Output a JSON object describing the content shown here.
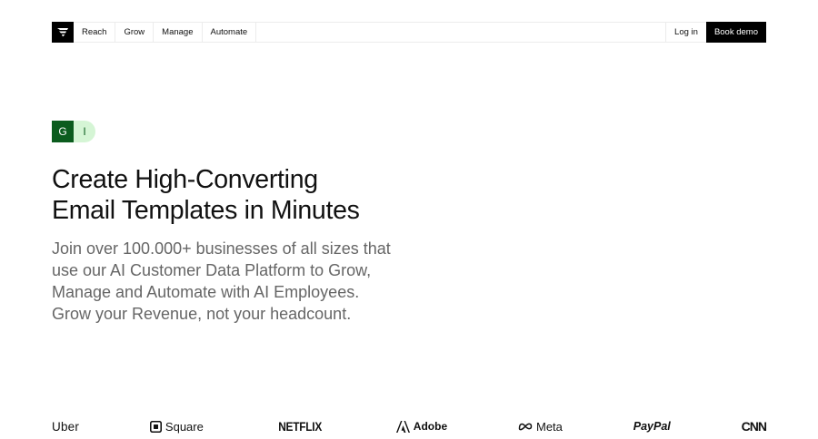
{
  "nav": {
    "links": [
      "Reach",
      "Grow",
      "Manage",
      "Automate"
    ],
    "login_label": "Log in",
    "demo_label": "Book demo"
  },
  "badges": {
    "first": "G",
    "second": "I"
  },
  "hero": {
    "headline_line1": "Create High-Converting",
    "headline_line2": "Email Templates in Minutes",
    "sub_line1": "Join over 100.000+ businesses of all sizes that",
    "sub_line2": "use our AI Customer Data Platform to Grow,",
    "sub_line3": "Manage and Automate with AI Employees.",
    "sub_line4": "Grow your Revenue, not your headcount."
  },
  "brands": [
    "Uber",
    "Square",
    "NETFLIX",
    "Adobe",
    "Meta",
    "PayPal",
    "CNN"
  ],
  "colors": {
    "brand_green": "#0b5c1e",
    "badge_light": "#d5f5d5",
    "button_dark": "#000000"
  }
}
